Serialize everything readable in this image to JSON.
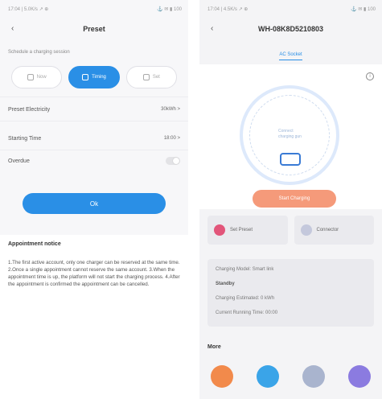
{
  "left": {
    "status_time": "17:04 | 5.0K/s ↗ ⊕",
    "status_right": "⚓ ✉ ▮ 100",
    "back_icon": "back-arrow-icon",
    "title": "Preset",
    "hint": "Schedule a charging session",
    "modes": [
      {
        "label": "Now",
        "icon": "clock-icon",
        "active": false
      },
      {
        "label": "Timing",
        "icon": "calendar-icon",
        "active": true
      },
      {
        "label": "Set",
        "icon": "bolt-icon",
        "active": false
      }
    ],
    "rows": [
      {
        "label": "Preset Electricity",
        "value": "30kWh >"
      },
      {
        "label": "Starting Time",
        "value": "18:00 >"
      },
      {
        "label": "Overdue",
        "value": ""
      }
    ],
    "ok_label": "Ok",
    "notice_title": "Appointment notice",
    "notice_body": "1.The first active account, only one charger can be reserved at the same time. 2.Once a single appointment cannot reserve the same account. 3.When the appointment time is up, the platform will not start the charging process. 4.After the appointment is confirmed the appointment can be cancelled."
  },
  "right": {
    "status_time": "17:04 | 4.5K/s ↗ ⊕",
    "status_right": "⚓ ✉ ▮ 100",
    "back_icon": "back-arrow-icon",
    "title": "WH-08K8D5210803",
    "tab_label": "AC Socket",
    "gauge_text_1": "Connect",
    "gauge_text_2": "charging gun",
    "start_label": "Start Charging",
    "card1_label": "Set Preset",
    "card2_label": "Connector",
    "info_lines": [
      "Charging Model: Smart link",
      "Standby",
      "Charging Estimated: 0 kWh",
      "Current Running Time: 00:00"
    ],
    "more_title": "More",
    "quick_colors": [
      "#f28a4b",
      "#3aa4e8",
      "#a9b4ce",
      "#8b7be0"
    ]
  }
}
